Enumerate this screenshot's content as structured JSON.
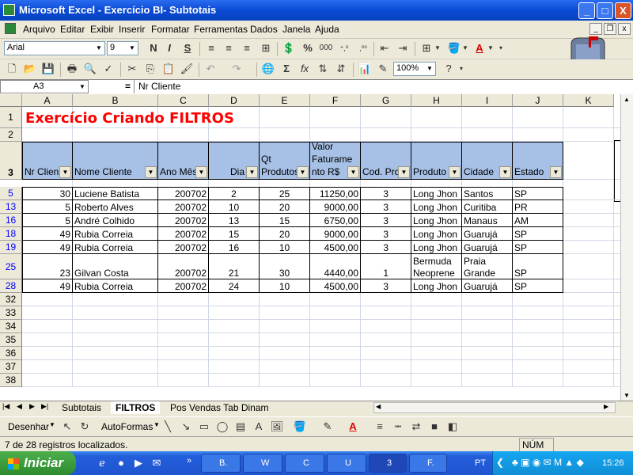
{
  "window": {
    "title": "Microsoft Excel - Exercício BI- Subtotais",
    "minimize": "_",
    "maximize": "□",
    "close": "X"
  },
  "menu": [
    "Arquivo",
    "Editar",
    "Exibir",
    "Inserir",
    "Formatar",
    "Ferramentas",
    "Dados",
    "Janela",
    "Ajuda"
  ],
  "formatting": {
    "font": "Arial",
    "size": "9",
    "bold": "N",
    "italic": "I",
    "underline": "S",
    "percent": "%",
    "thousands": "000",
    "inc_decimal": "⁺,⁰",
    "dec_decimal": ",⁰⁰"
  },
  "standard": {
    "zoom": "100%"
  },
  "formula": {
    "name_box": "A3",
    "equals": "=",
    "content": "Nr Cliente"
  },
  "columns": [
    "A",
    "B",
    "C",
    "D",
    "E",
    "F",
    "G",
    "H",
    "I",
    "J",
    "K"
  ],
  "title_cell": {
    "row": "1",
    "text": "Exercício Criando FILTROS",
    "color": "#ff0000"
  },
  "header_row": {
    "row": "3",
    "labels": [
      "Nr Clien",
      "Nome Cliente",
      "Ano Mês",
      "Dia",
      "Qt\nProdutos",
      "Valor\nFaturame\nnto R$",
      "Cod. Pro",
      "Produto",
      "Cidade",
      "Estado"
    ],
    "fill": "#a6c0e6"
  },
  "rows": [
    {
      "n": "5",
      "vals": [
        "30",
        "Luciene Batista",
        "200702",
        "2",
        "25",
        "11250,00",
        "3",
        "Long Jhon",
        "Santos",
        "SP"
      ]
    },
    {
      "n": "13",
      "vals": [
        "5",
        "Roberto Alves",
        "200702",
        "10",
        "20",
        "9000,00",
        "3",
        "Long Jhon",
        "Curitiba",
        "PR"
      ]
    },
    {
      "n": "16",
      "vals": [
        "5",
        "André Colhido",
        "200702",
        "13",
        "15",
        "6750,00",
        "3",
        "Long Jhon",
        "Manaus",
        "AM"
      ]
    },
    {
      "n": "18",
      "vals": [
        "49",
        "Rubia Correia",
        "200702",
        "15",
        "20",
        "9000,00",
        "3",
        "Long Jhon",
        "Guarujá",
        "SP"
      ]
    },
    {
      "n": "19",
      "vals": [
        "49",
        "Rubia Correia",
        "200702",
        "16",
        "10",
        "4500,00",
        "3",
        "Long Jhon",
        "Guarujá",
        "SP"
      ]
    },
    {
      "n": "25",
      "vals": [
        "23",
        "Gilvan Costa",
        "200702",
        "21",
        "30",
        "4440,00",
        "1",
        "Bermuda\nNeoprene",
        "Praia\nGrande",
        "SP"
      ]
    },
    {
      "n": "28",
      "vals": [
        "49",
        "Rubia Correia",
        "200702",
        "24",
        "10",
        "4500,00",
        "3",
        "Long Jhon",
        "Guarujá",
        "SP"
      ]
    }
  ],
  "empty_rows": [
    "32",
    "33",
    "34",
    "35",
    "36",
    "37",
    "38"
  ],
  "plain_rows": [
    "2"
  ],
  "sheets": [
    "Subtotais",
    "FILTROS",
    "Pos Vendas Tab Dinam"
  ],
  "active_sheet": "FILTROS",
  "drawing": {
    "draw_label": "Desenhar",
    "autoshapes_label": "AutoFormas"
  },
  "status": {
    "message": "7 de 28 registros localizados.",
    "num": "NÚM"
  },
  "taskbar": {
    "start": "Iniciar",
    "buttons": [
      {
        "label": "B."
      },
      {
        "label": "W"
      },
      {
        "label": "C"
      },
      {
        "label": "U"
      },
      {
        "label": "3"
      },
      {
        "label": "F."
      }
    ],
    "lang": "PT",
    "clock": "15:26"
  }
}
